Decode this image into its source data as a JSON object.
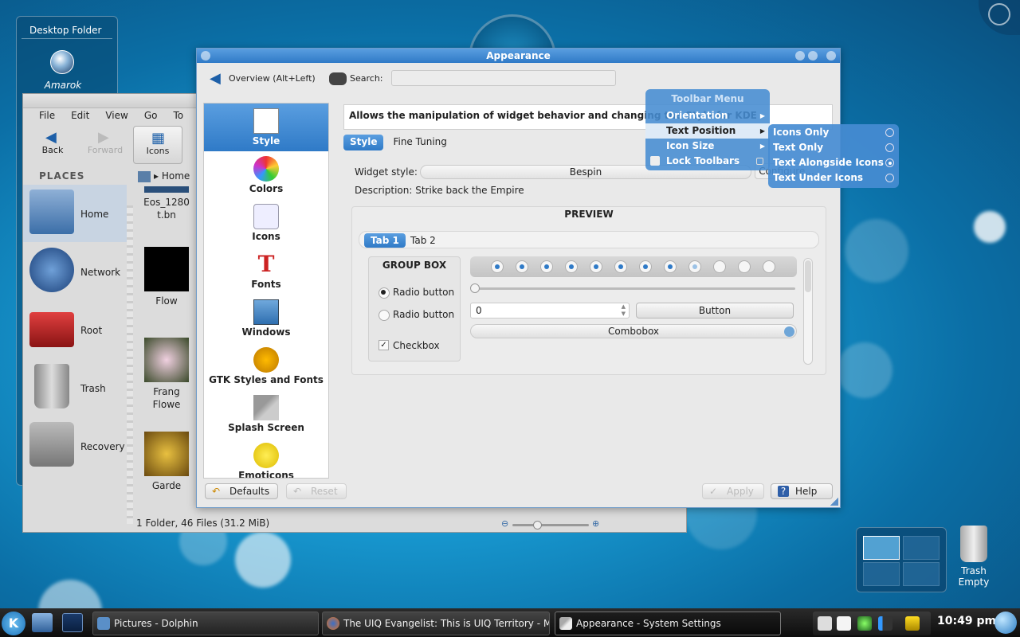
{
  "desktop_folder": {
    "title": "Desktop Folder",
    "items": [
      {
        "label": "Amarok"
      }
    ]
  },
  "dolphin": {
    "menu": [
      "File",
      "Edit",
      "View",
      "Go",
      "To"
    ],
    "toolbar": {
      "back": "Back",
      "forward": "Forward",
      "icons": "Icons"
    },
    "places_header": "PLACES",
    "places": [
      "Home",
      "Network",
      "Root",
      "Trash",
      "Recovery"
    ],
    "breadcrumb": "Home",
    "files": [
      {
        "name_1": "Eos_1280",
        "name_2": "t.bn"
      },
      {
        "name_1": "Flow",
        "name_2": ""
      },
      {
        "name_1": "Frang",
        "name_2": "Flowe"
      },
      {
        "name_1": "Garde",
        "name_2": ""
      }
    ],
    "status": "1 Folder, 46 Files (31.2 MiB)"
  },
  "appearance": {
    "title": "Appearance",
    "overview": "Overview (Alt+Left)",
    "search_label": "Search:",
    "categories": [
      "Style",
      "Colors",
      "Icons",
      "Fonts",
      "Windows",
      "GTK Styles and Fonts",
      "Splash Screen",
      "Emoticons"
    ],
    "description": "Allows the manipulation of widget behavior and changing the Style for KDE",
    "tabs": [
      "Style",
      "Fine Tuning"
    ],
    "widget_style_label": "Widget style:",
    "widget_style_value": "Bespin",
    "configure": "Configure...",
    "style_description": "Description: Strike back the Empire",
    "preview": {
      "title": "PREVIEW",
      "tabs": [
        "Tab 1",
        "Tab 2"
      ],
      "group_box": "GROUP BOX",
      "radio_1": "Radio button",
      "radio_2": "Radio button",
      "checkbox": "Checkbox",
      "spin_value": "0",
      "button": "Button",
      "combobox": "Combobox",
      "progress_dots": {
        "filled": 8,
        "half": 1,
        "total": 12
      }
    },
    "footer": {
      "defaults": "Defaults",
      "reset": "Reset",
      "apply": "Apply",
      "help": "Help"
    }
  },
  "toolbar_menu": {
    "title": "Toolbar Menu",
    "items": [
      "Orientation",
      "Text Position",
      "Icon Size",
      "Lock Toolbars"
    ],
    "highlighted": "Text Position",
    "submenu": [
      "Icons Only",
      "Text Only",
      "Text Alongside Icons",
      "Text Under Icons"
    ],
    "submenu_selected": "Text Alongside Icons"
  },
  "trash_widget": {
    "line_1": "Trash",
    "line_2": "Empty"
  },
  "taskbar": {
    "tasks": [
      "Pictures - Dolphin",
      "The UIQ Evangelist: This is UIQ Territory - M",
      "Appearance - System Settings"
    ],
    "clock": "10:49 pm"
  },
  "colors": {
    "accent": "#2f7ac7",
    "desktop": "#1aa0d8"
  }
}
